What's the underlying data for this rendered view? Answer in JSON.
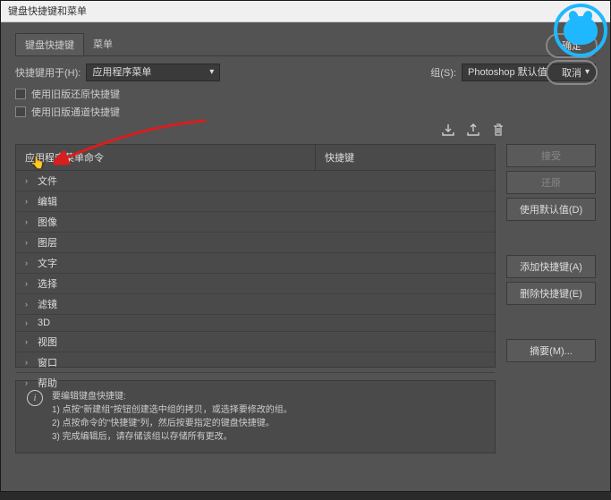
{
  "window": {
    "title": "键盘快捷键和菜单"
  },
  "tabs": {
    "shortcuts": "键盘快捷键",
    "menus": "菜单"
  },
  "shortcutsFor": {
    "label": "快捷键用于(H):",
    "value": "应用程序菜单"
  },
  "set": {
    "label": "组(S):",
    "value": "Photoshop 默认值"
  },
  "legacy": {
    "undo": "使用旧版还原快捷键",
    "channel": "使用旧版通道快捷键"
  },
  "columns": {
    "cmd": "应用程序菜单命令",
    "shortcut": "快捷键"
  },
  "tree": [
    "文件",
    "编辑",
    "图像",
    "图层",
    "文字",
    "选择",
    "滤镜",
    "3D",
    "视图",
    "窗口",
    "帮助"
  ],
  "buttons": {
    "ok": "确定",
    "cancel": "取消",
    "accept": "接受",
    "undo": "还原",
    "useDefault": "使用默认值(D)",
    "add": "添加快捷键(A)",
    "delete": "删除快捷键(E)",
    "summarize": "摘要(M)..."
  },
  "info": {
    "title": "要编辑键盘快捷键:",
    "l1": "1) 点按\"新建组\"按钮创建选中组的拷贝，或选择要修改的组。",
    "l2": "2) 点按命令的\"快捷键\"列，然后按要指定的键盘快捷键。",
    "l3": "3) 完成编辑后，请存储该组以存储所有更改。"
  }
}
